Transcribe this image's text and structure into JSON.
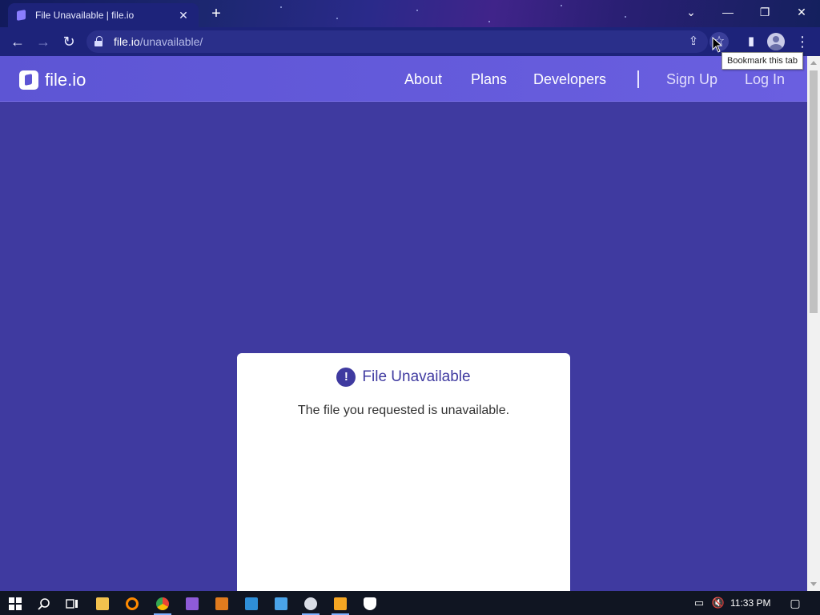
{
  "browser": {
    "tab_title": "File Unavailable | file.io",
    "tab_close": "✕",
    "new_tab": "+",
    "url_host": "file.io",
    "url_path": "/unavailable/",
    "tooltip": "Bookmark this tab",
    "window_controls": {
      "tab_search": "⌄",
      "minimize": "—",
      "restore": "❐",
      "close": "✕"
    },
    "toolbar_icons": {
      "back": "←",
      "forward": "→",
      "reload": "↻",
      "share": "⇪",
      "bookmark": "☆",
      "side_panel": "▮",
      "menu": "⋮"
    }
  },
  "site": {
    "logo_text": "file.io",
    "nav": {
      "about": "About",
      "plans": "Plans",
      "developers": "Developers",
      "sign_up": "Sign Up",
      "log_in": "Log In"
    }
  },
  "card": {
    "icon": "!",
    "title": "File Unavailable",
    "message": "The file you requested is unavailable."
  },
  "taskbar": {
    "time": "11:33 PM"
  },
  "colors": {
    "page_bg": "#3f3aa0",
    "nav_bg": "#5d55d4",
    "browser_chrome": "#1d237a",
    "taskbar": "#101522"
  }
}
